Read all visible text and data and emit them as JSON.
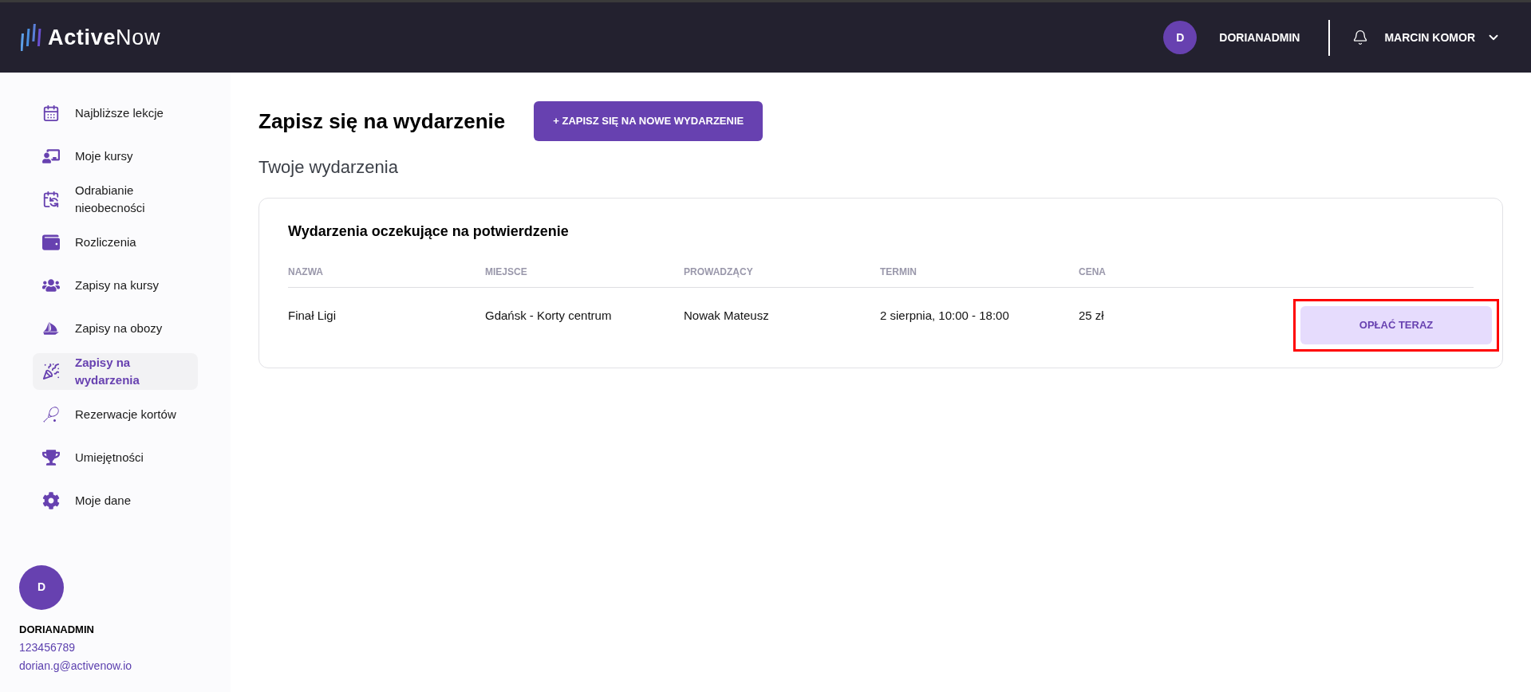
{
  "header": {
    "logo_bold": "Active",
    "logo_light": "Now",
    "avatar_letter": "D",
    "account": "DORIANADMIN",
    "user_menu": "MARCIN KOMOR"
  },
  "sidebar": {
    "items": [
      {
        "label": "Najbliższe lekcje",
        "selected": false
      },
      {
        "label": "Moje kursy",
        "selected": false
      },
      {
        "label": "Odrabianie nieobecności",
        "selected": false
      },
      {
        "label": "Rozliczenia",
        "selected": false
      },
      {
        "label": "Zapisy na kursy",
        "selected": false
      },
      {
        "label": "Zapisy na obozy",
        "selected": false
      },
      {
        "label": "Zapisy na wydarzenia",
        "selected": true
      },
      {
        "label": "Rezerwacje kortów",
        "selected": false
      },
      {
        "label": "Umiejętności",
        "selected": false
      },
      {
        "label": "Moje dane",
        "selected": false
      }
    ],
    "profile": {
      "avatar_letter": "D",
      "name": "DORIANADMIN",
      "phone": "123456789",
      "email": "dorian.g@activenow.io"
    }
  },
  "page": {
    "title": "Zapisz się na wydarzenie",
    "new_button": "+ ZAPISZ SIĘ NA NOWE WYDARZENIE",
    "subtitle": "Twoje wydarzenia"
  },
  "card": {
    "title": "Wydarzenia oczekujące na potwierdzenie",
    "columns": [
      "NAZWA",
      "MIEJSCE",
      "PROWADZĄCY",
      "TERMIN",
      "CENA"
    ],
    "rows": [
      {
        "cells": [
          "Finał Ligi",
          "Gdańsk - Korty centrum",
          "Nowak Mateusz",
          "2 sierpnia, 10:00 - 18:00",
          "25 zł"
        ],
        "action": "OPŁAĆ TERAZ",
        "highlighted": true
      }
    ]
  }
}
